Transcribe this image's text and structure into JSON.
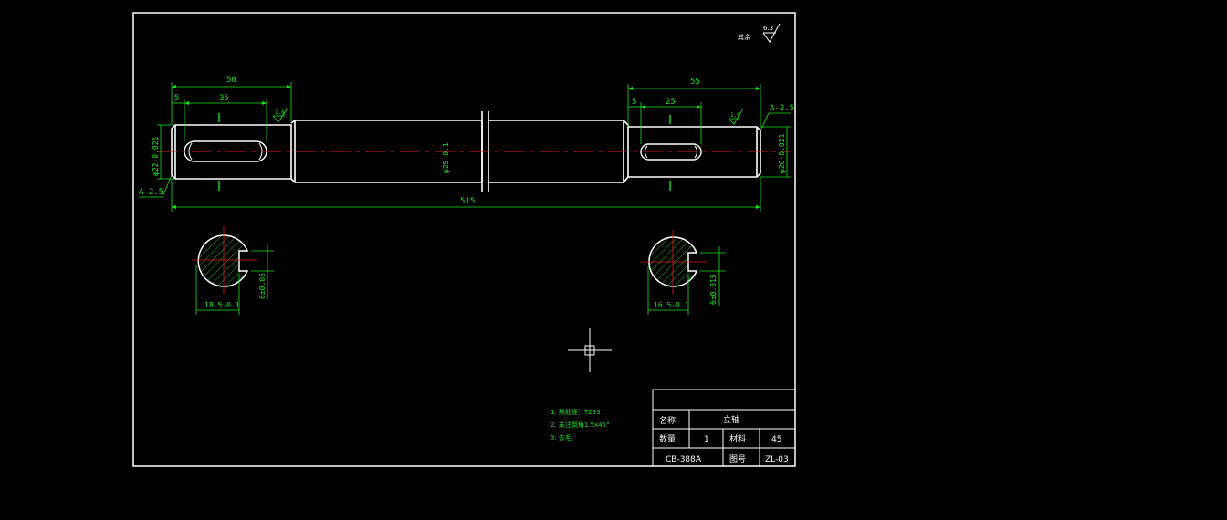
{
  "surface_finish": {
    "label": "其余",
    "value": "6.3"
  },
  "dimensions": {
    "left_key_length": "50",
    "left_key_inner": "35",
    "left_offset": "5",
    "right_key_length": "55",
    "right_key_inner": "25",
    "right_offset": "5",
    "total_length": "515",
    "left_diameter": "φ22-0.021",
    "mid_diameter": "φ25-0.1",
    "right_diameter": "φ20-0.021",
    "left_roughness": "1.6",
    "right_roughness": "1.6",
    "section_left_mark": "A-2.5",
    "section_right_mark": "A-2.5"
  },
  "sections": {
    "left_depth": "18.5-0.1",
    "left_width": "6±0.05",
    "right_depth": "16.5-0.1",
    "right_width": "6±0.015"
  },
  "notes": [
    "1. 热处理：T235",
    "2. 未注倒角1.5x45°",
    "3. 去毛"
  ],
  "title_block": {
    "name_label": "名称",
    "name_value": "立轴",
    "qty_label": "数量",
    "qty_value": "1",
    "material_label": "材料",
    "material_value": "45",
    "drawing_code": "CB-388A",
    "drawing_no_label": "图号",
    "drawing_no_value": "ZL-03"
  }
}
